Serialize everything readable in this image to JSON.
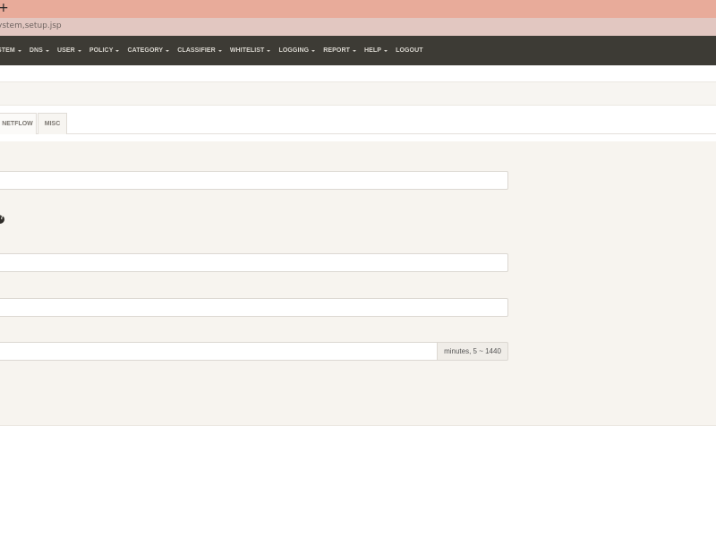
{
  "browser": {
    "new_tab_symbol": "+",
    "url": "ystem,setup.jsp"
  },
  "nav": {
    "items": [
      {
        "label": "STEM",
        "caret": true
      },
      {
        "label": "DNS",
        "caret": true
      },
      {
        "label": "USER",
        "caret": true
      },
      {
        "label": "POLICY",
        "caret": true
      },
      {
        "label": "CATEGORY",
        "caret": true
      },
      {
        "label": "CLASSIFIER",
        "caret": true
      },
      {
        "label": "WHITELIST",
        "caret": true
      },
      {
        "label": "LOGGING",
        "caret": true
      },
      {
        "label": "REPORT",
        "caret": true
      },
      {
        "label": "HELP",
        "caret": true
      },
      {
        "label": "LOGOUT",
        "caret": false
      }
    ]
  },
  "tabs": {
    "netflow": "NETFLOW",
    "misc": "MISC"
  },
  "form": {
    "field1_value": "",
    "field2_value": "",
    "field3_value": "",
    "field4_value": "",
    "field4_addon": "minutes, 5 ~ 1440"
  },
  "colors": {
    "tabstrip": "#e8ab9a",
    "addressbar": "#e2c7c1",
    "navbar": "#3d3b35",
    "panel": "#f7f4ef"
  }
}
